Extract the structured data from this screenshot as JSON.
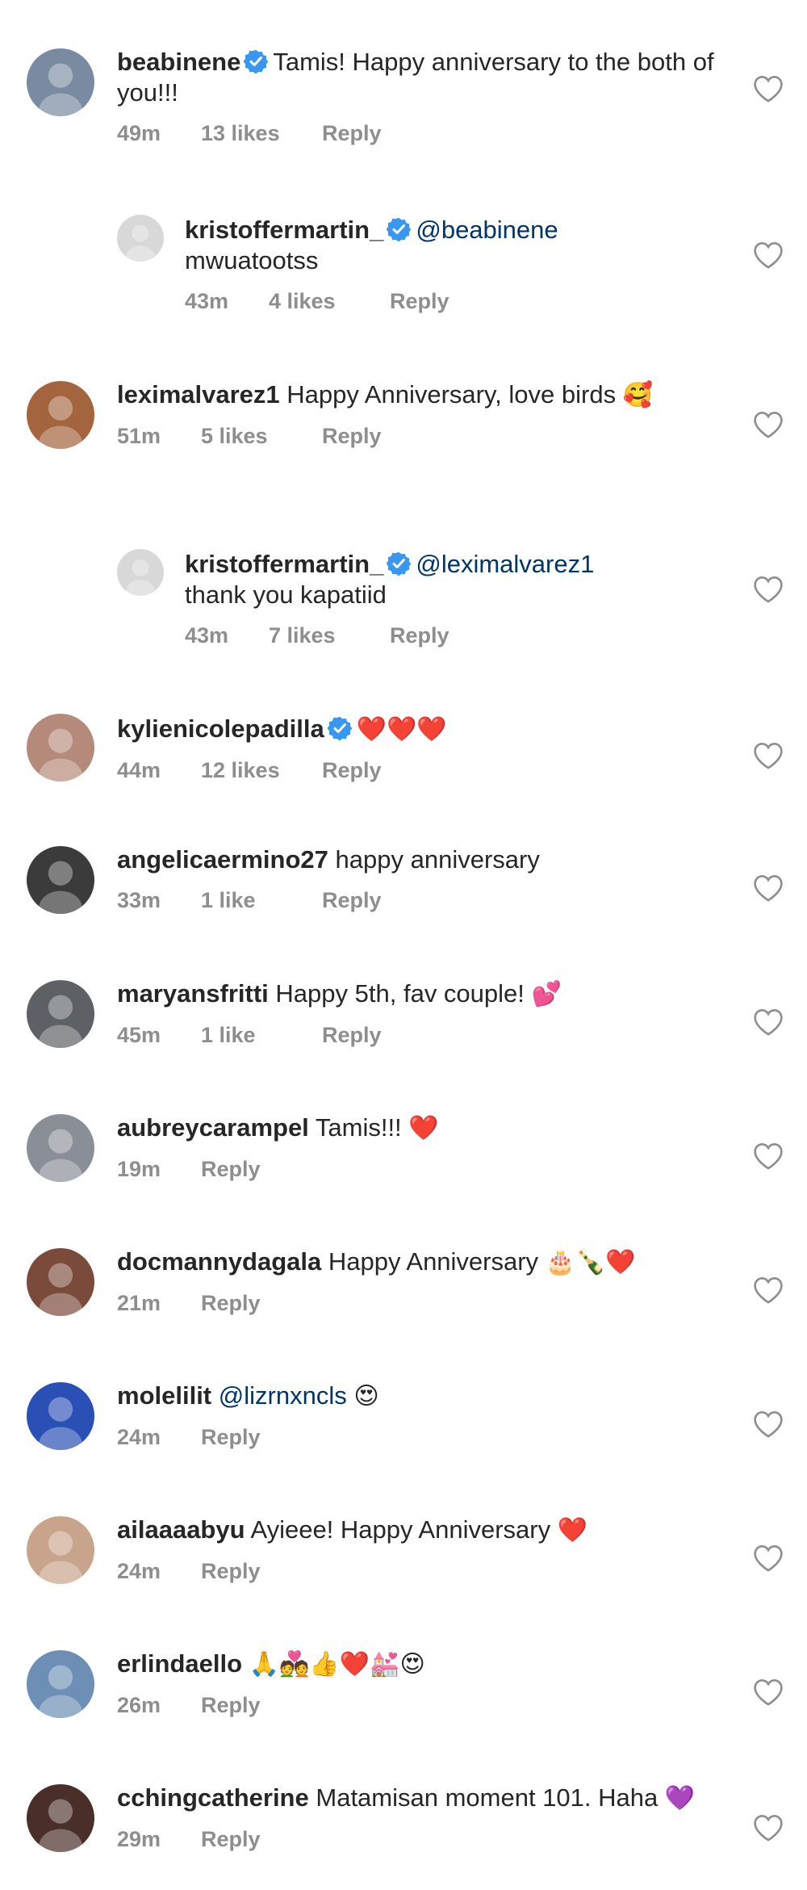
{
  "comments": [
    {
      "username": "beabinene",
      "verified": true,
      "mention": "",
      "text": "Tamis! Happy anniversary to the both of you!!!",
      "emoji": "",
      "time": "49m",
      "likes": "13 likes",
      "reply": "Reply",
      "is_reply": false,
      "avatar_color": "#7a8aa0"
    },
    {
      "username": "kristoffermartin_",
      "verified": true,
      "mention": "@beabinene",
      "text": "mwuatootss",
      "emoji": "",
      "time": "43m",
      "likes": "4 likes",
      "reply": "Reply",
      "is_reply": true,
      "avatar_color": "#d8d8d8"
    },
    {
      "username": "leximalvarez1",
      "verified": false,
      "mention": "",
      "text": "Happy Anniversary, love birds",
      "emoji": "🥰",
      "time": "51m",
      "likes": "5 likes",
      "reply": "Reply",
      "is_reply": false,
      "avatar_color": "#a4643e"
    },
    {
      "username": "kristoffermartin_",
      "verified": true,
      "mention": "@leximalvarez1",
      "text": "thank you kapatiid",
      "emoji": "",
      "time": "43m",
      "likes": "7 likes",
      "reply": "Reply",
      "is_reply": true,
      "avatar_color": "#d8d8d8"
    },
    {
      "username": "kylienicolepadilla",
      "verified": true,
      "mention": "",
      "text": "",
      "emoji": "❤️❤️❤️",
      "time": "44m",
      "likes": "12 likes",
      "reply": "Reply",
      "is_reply": false,
      "avatar_color": "#b58a7a"
    },
    {
      "username": "angelicaermino27",
      "verified": false,
      "mention": "",
      "text": "happy anniversary",
      "emoji": "",
      "time": "33m",
      "likes": "1 like",
      "reply": "Reply",
      "is_reply": false,
      "avatar_color": "#3b3b3b"
    },
    {
      "username": "maryansfritti",
      "verified": false,
      "mention": "",
      "text": "Happy 5th, fav couple!",
      "emoji": "💕",
      "time": "45m",
      "likes": "1 like",
      "reply": "Reply",
      "is_reply": false,
      "avatar_color": "#5d6166"
    },
    {
      "username": "aubreycarampel",
      "verified": false,
      "mention": "",
      "text": "Tamis!!!",
      "emoji": "❤️",
      "time": "19m",
      "likes": "",
      "reply": "Reply",
      "is_reply": false,
      "avatar_color": "#8a8f97"
    },
    {
      "username": "docmannydagala",
      "verified": false,
      "mention": "",
      "text": "Happy Anniversary",
      "emoji": "🎂🍾❤️",
      "time": "21m",
      "likes": "",
      "reply": "Reply",
      "is_reply": false,
      "avatar_color": "#7a4a3a"
    },
    {
      "username": "molelilit",
      "verified": false,
      "mention": "@lizrnxncls",
      "text": "",
      "emoji": "😍",
      "time": "24m",
      "likes": "",
      "reply": "Reply",
      "is_reply": false,
      "avatar_color": "#2a4fb5"
    },
    {
      "username": "ailaaaabyu",
      "verified": false,
      "mention": "",
      "text": "Ayieee! Happy Anniversary",
      "emoji": "❤️",
      "time": "24m",
      "likes": "",
      "reply": "Reply",
      "is_reply": false,
      "avatar_color": "#c9a48c"
    },
    {
      "username": "erlindaello",
      "verified": false,
      "mention": "",
      "text": "",
      "emoji": "🙏💑👍❤️💒😍",
      "time": "26m",
      "likes": "",
      "reply": "Reply",
      "is_reply": false,
      "avatar_color": "#6d8fb5"
    },
    {
      "username": "cchingcatherine",
      "verified": false,
      "mention": "",
      "text": "Matamisan moment 101. Haha",
      "emoji": "💜",
      "time": "29m",
      "likes": "",
      "reply": "Reply",
      "is_reply": false,
      "avatar_color": "#4a2e2a"
    }
  ],
  "icons": {
    "like": "heart-outline-icon",
    "verified": "verified-badge-icon"
  },
  "colors": {
    "verified_blue": "#3897f0",
    "meta_gray": "#8e8e8e",
    "mention_blue": "#003569"
  }
}
